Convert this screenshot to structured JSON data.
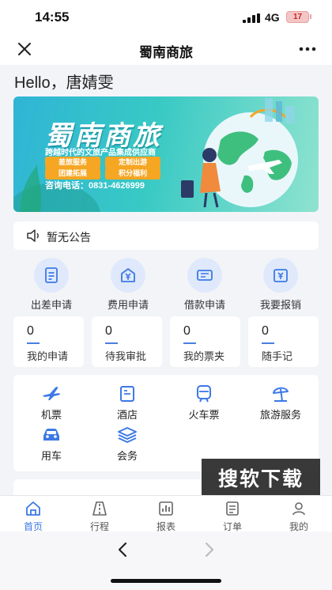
{
  "status_bar": {
    "time": "14:55",
    "network": "4G",
    "battery": "17"
  },
  "nav": {
    "title": "蜀南商旅"
  },
  "greeting": "Hello，唐婧雯",
  "banner": {
    "title": "蜀南商旅",
    "subtitle": "跨越时代的文旅产品集成供应商",
    "tags": [
      "差旅服务",
      "定制出游",
      "团建拓展",
      "积分福利"
    ],
    "phone": "咨询电话：0831-4626999"
  },
  "notice": {
    "text": "暂无公告"
  },
  "quick_actions": [
    {
      "label": "出差申请",
      "icon": "document-icon"
    },
    {
      "label": "费用申请",
      "icon": "yuan-house-icon"
    },
    {
      "label": "借款申请",
      "icon": "money-bill-icon"
    },
    {
      "label": "我要报销",
      "icon": "reimburse-icon"
    }
  ],
  "stats": [
    {
      "value": "0",
      "label": "我的申请"
    },
    {
      "value": "0",
      "label": "待我审批"
    },
    {
      "value": "0",
      "label": "我的票夹"
    },
    {
      "value": "0",
      "label": "随手记"
    }
  ],
  "services": [
    {
      "label": "机票",
      "icon": "airplane-icon"
    },
    {
      "label": "酒店",
      "icon": "hotel-icon"
    },
    {
      "label": "火车票",
      "icon": "train-icon"
    },
    {
      "label": "旅游服务",
      "icon": "beach-umbrella-icon"
    },
    {
      "label": "用车",
      "icon": "car-icon"
    },
    {
      "label": "会务",
      "icon": "layers-icon"
    }
  ],
  "watermark": "搜软下载",
  "tabs": [
    {
      "label": "首页",
      "active": true
    },
    {
      "label": "行程",
      "active": false
    },
    {
      "label": "报表",
      "active": false
    },
    {
      "label": "订单",
      "active": false
    },
    {
      "label": "我的",
      "active": false
    }
  ],
  "colors": {
    "accent": "#3c79e6",
    "icon_bg": "#dfe9fb",
    "tag": "#f5a623",
    "banner_start": "#2fb5d6",
    "banner_end": "#8fe3cf"
  }
}
